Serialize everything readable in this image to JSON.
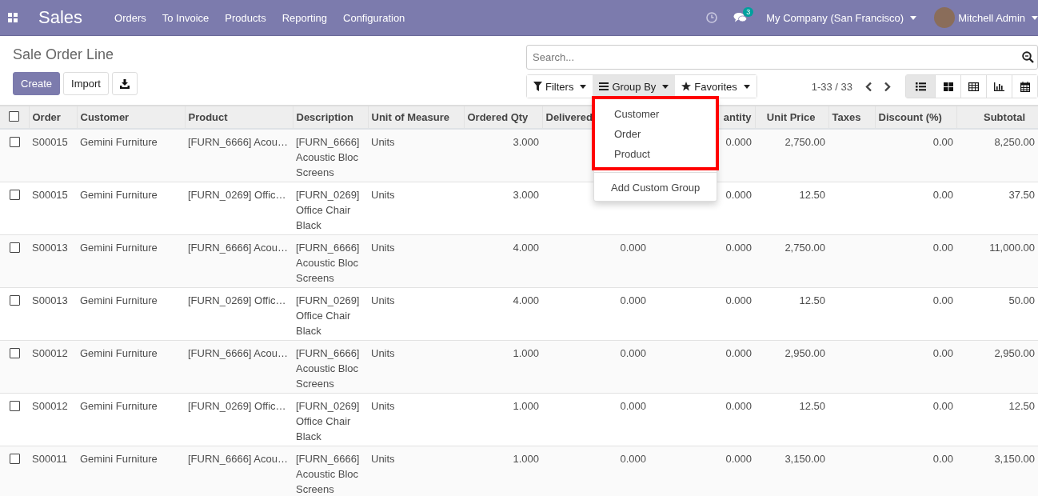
{
  "navbar": {
    "app_name": "Sales",
    "menu": [
      "Orders",
      "To Invoice",
      "Products",
      "Reporting",
      "Configuration"
    ],
    "messages_badge": "3",
    "company": "My Company (San Francisco)",
    "user": "Mitchell Admin"
  },
  "control_panel": {
    "title": "Sale Order Line",
    "buttons": [
      {
        "label": "Create",
        "kind": "primary"
      },
      {
        "label": "Import",
        "kind": "secondary"
      }
    ],
    "search": {
      "placeholder": "Search..."
    },
    "search_buttons": [
      {
        "label": "Filters",
        "kind": "filter",
        "selected": false
      },
      {
        "label": "Group By",
        "kind": "group",
        "selected": true
      },
      {
        "label": "Favorites",
        "kind": "star",
        "selected": false
      }
    ],
    "pager": "1-33 / 33",
    "views": [
      {
        "kind": "list",
        "selected": true
      },
      {
        "kind": "kanban",
        "selected": false
      },
      {
        "kind": "pivot",
        "selected": false
      },
      {
        "kind": "graph",
        "selected": false
      },
      {
        "kind": "calendar",
        "selected": false
      }
    ]
  },
  "group_by_menu": {
    "items": [
      "Customer",
      "Order",
      "Product"
    ],
    "custom_group": "Add Custom Group",
    "highlighted": true
  },
  "table": {
    "header_checked": false,
    "columns": [
      "Order",
      "Customer",
      "Product",
      "Description",
      "Unit of Measure",
      "Ordered Qty",
      "Delivered",
      "antity",
      "Unit Price",
      "Taxes",
      "Discount (%)",
      "Subtotal"
    ],
    "rows": [
      {
        "checked": false,
        "cells": [
          "S00015",
          "Gemini Furniture",
          "[FURN_6666] Acou…",
          "[FURN_6666] Acoustic Bloc Screens",
          "Units",
          "3.000",
          "",
          "0.000",
          "2,750.00",
          "",
          "0.00",
          "8,250.00"
        ]
      },
      {
        "checked": false,
        "cells": [
          "S00015",
          "Gemini Furniture",
          "[FURN_0269] Offic…",
          "[FURN_0269] Office Chair Black",
          "Units",
          "3.000",
          "",
          "0.000",
          "12.50",
          "",
          "0.00",
          "37.50"
        ]
      },
      {
        "checked": false,
        "cells": [
          "S00013",
          "Gemini Furniture",
          "[FURN_6666] Acou…",
          "[FURN_6666] Acoustic Bloc Screens",
          "Units",
          "4.000",
          "0.000",
          "0.000",
          "2,750.00",
          "",
          "0.00",
          "11,000.00"
        ]
      },
      {
        "checked": false,
        "cells": [
          "S00013",
          "Gemini Furniture",
          "[FURN_0269] Offic…",
          "[FURN_0269] Office Chair Black",
          "Units",
          "4.000",
          "0.000",
          "0.000",
          "12.50",
          "",
          "0.00",
          "50.00"
        ]
      },
      {
        "checked": false,
        "cells": [
          "S00012",
          "Gemini Furniture",
          "[FURN_6666] Acou…",
          "[FURN_6666] Acoustic Bloc Screens",
          "Units",
          "1.000",
          "0.000",
          "0.000",
          "2,950.00",
          "",
          "0.00",
          "2,950.00"
        ]
      },
      {
        "checked": false,
        "cells": [
          "S00012",
          "Gemini Furniture",
          "[FURN_0269] Offic…",
          "[FURN_0269] Office Chair Black",
          "Units",
          "1.000",
          "0.000",
          "0.000",
          "12.50",
          "",
          "0.00",
          "12.50"
        ]
      },
      {
        "checked": false,
        "cells": [
          "S00011",
          "Gemini Furniture",
          "[FURN_6666] Acou…",
          "[FURN_6666] Acoustic Bloc Screens",
          "Units",
          "1.000",
          "0.000",
          "0.000",
          "3,150.00",
          "",
          "0.00",
          "3,150.00"
        ]
      }
    ]
  }
}
